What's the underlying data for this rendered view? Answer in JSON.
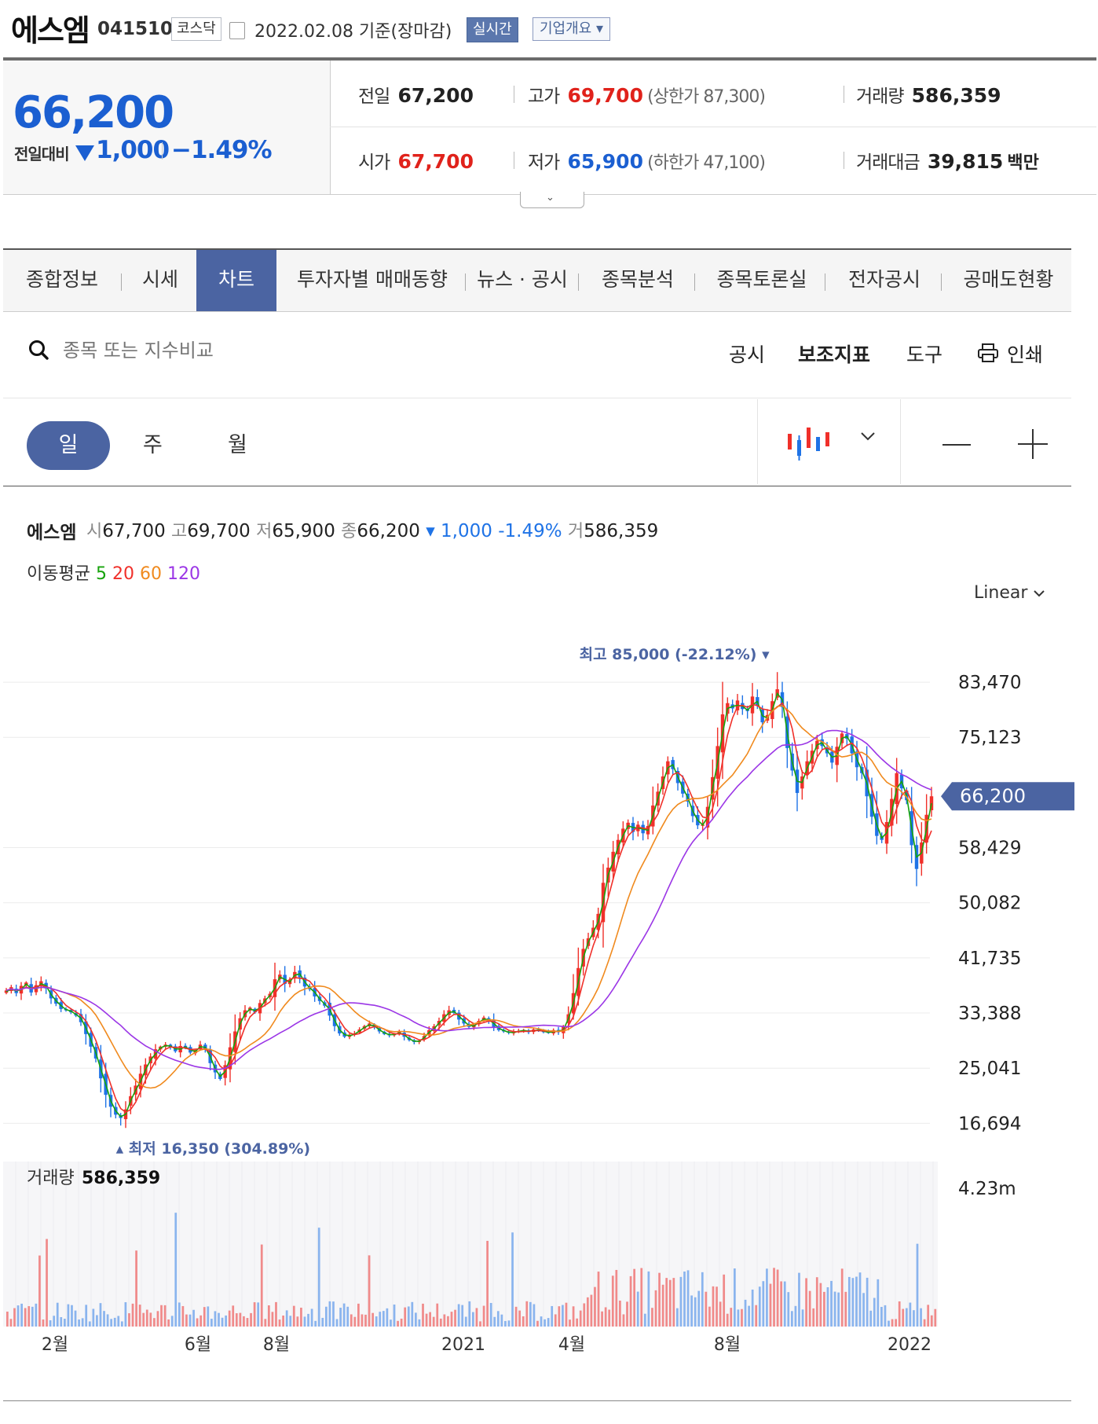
{
  "header": {
    "name": "에스엠",
    "code": "041510",
    "market": "코스닥",
    "date": "2022.02.08",
    "date_suffix": "기준(장마감)",
    "realtime_label": "실시간",
    "company_label": "기업개요",
    "company_caret": "▾"
  },
  "price": {
    "current": "66,200",
    "change_label": "전일대비",
    "change": "1,000",
    "change_pct": "−1.49%"
  },
  "quotes": {
    "prev_label": "전일",
    "prev": "67,200",
    "high_label": "고가",
    "high": "69,700",
    "upper_limit": "(상한가 87,300)",
    "volume_label": "거래량",
    "volume": "586,359",
    "open_label": "시가",
    "open": "67,700",
    "low_label": "저가",
    "low": "65,900",
    "lower_limit": "(하한가 47,100)",
    "amount_label": "거래대금",
    "amount": "39,815",
    "amount_unit": "백만"
  },
  "tabs": [
    {
      "label": "종합정보"
    },
    {
      "label": "시세"
    },
    {
      "label": "차트",
      "active": true
    },
    {
      "label": "투자자별 매매동향"
    },
    {
      "label": "뉴스 · 공시"
    },
    {
      "label": "종목분석"
    },
    {
      "label": "종목토론실"
    },
    {
      "label": "전자공시"
    },
    {
      "label": "공매도현황"
    }
  ],
  "toolbar": {
    "search_placeholder": "종목 또는 지수비교",
    "disclosure": "공시",
    "indicators": "보조지표",
    "tools": "도구",
    "print": "인쇄"
  },
  "period": {
    "day": "일",
    "week": "주",
    "month": "월"
  },
  "info": {
    "name": "에스엠",
    "open_lbl": "시",
    "open": "67,700",
    "high_lbl": "고",
    "high": "69,700",
    "low_lbl": "저",
    "low": "65,900",
    "close_lbl": "종",
    "close": "66,200",
    "change": "▾ 1,000 -1.49%",
    "vol_lbl": "거",
    "volume": "586,359",
    "ma_label": "이동평균",
    "ma": [
      {
        "n": "5",
        "color": "#16a30b"
      },
      {
        "n": "20",
        "color": "#f0302a"
      },
      {
        "n": "60",
        "color": "#f08a1e"
      },
      {
        "n": "120",
        "color": "#9b36e6"
      }
    ]
  },
  "scale": "Linear",
  "colors": {
    "up": "#f0302a",
    "down": "#1f73e6",
    "accent": "#4b64a2"
  },
  "chart_data": {
    "type": "candlestick",
    "y_ticks": [
      "83,470",
      "75,123",
      "66,200",
      "58,429",
      "50,082",
      "41,735",
      "33,388",
      "25,041",
      "16,694"
    ],
    "ylim": [
      14000,
      88000
    ],
    "x_ticks": [
      "2월",
      "6월",
      "8월",
      "2021",
      "4월",
      "8월",
      "2022"
    ],
    "current_label": "66,200",
    "current": 66200,
    "high_annotation": "최고 85,000 (-22.12%)",
    "high_value": 85000,
    "low_annotation": "최저 16,350 (304.89%)",
    "low_value": 16350,
    "volume_label": "거래량",
    "volume_value": "586,359",
    "volume_tick": "4.23m",
    "volume_max": 4230000,
    "close_series": [
      36800,
      37300,
      36400,
      37500,
      38000,
      36500,
      37600,
      38200,
      37100,
      35600,
      34800,
      34000,
      33800,
      33500,
      33000,
      32000,
      30200,
      28300,
      26500,
      23500,
      21000,
      19200,
      18000,
      17500,
      18800,
      20800,
      22400,
      24200,
      25600,
      26800,
      27900,
      28300,
      28600,
      28200,
      27600,
      28400,
      28100,
      27400,
      27800,
      28600,
      27800,
      25800,
      24400,
      23400,
      25500,
      28200,
      30600,
      32600,
      33800,
      34200,
      33500,
      34900,
      35600,
      36300,
      38500,
      39200,
      37800,
      38400,
      39600,
      38800,
      37400,
      37000,
      35900,
      35200,
      34500,
      33000,
      31400,
      30300,
      29800,
      30100,
      30300,
      30900,
      31400,
      31800,
      31200,
      30600,
      30200,
      30000,
      30200,
      30600,
      29800,
      29300,
      29000,
      29200,
      29900,
      30800,
      31400,
      32200,
      33200,
      33800,
      33400,
      32400,
      31800,
      31300,
      31600,
      32200,
      32700,
      32200,
      31300,
      30800,
      30600,
      30400,
      30500,
      30700,
      30800,
      30500,
      30900,
      30700,
      30600,
      30400,
      30800,
      30500,
      31300,
      33200,
      36400,
      40200,
      43100,
      44700,
      46300,
      48400,
      53100,
      55400,
      57800,
      59600,
      61300,
      62200,
      60800,
      61900,
      60600,
      61700,
      64800,
      66900,
      69200,
      71500,
      70300,
      68200,
      66600,
      65400,
      63200,
      61800,
      61900,
      64600,
      69100,
      73800,
      78600,
      80300,
      79500,
      80700,
      79400,
      79100,
      81300,
      79900,
      77400,
      78500,
      80600,
      82400,
      79700,
      73500,
      70100,
      66700,
      69200,
      71500,
      73100,
      74600,
      73800,
      72700,
      71300,
      73700,
      75700,
      74900,
      72700,
      70600,
      69700,
      66200,
      63100,
      60200,
      59600,
      62300,
      65800,
      69700,
      67400,
      65600,
      58800,
      55200,
      59200,
      63400,
      66200
    ]
  }
}
